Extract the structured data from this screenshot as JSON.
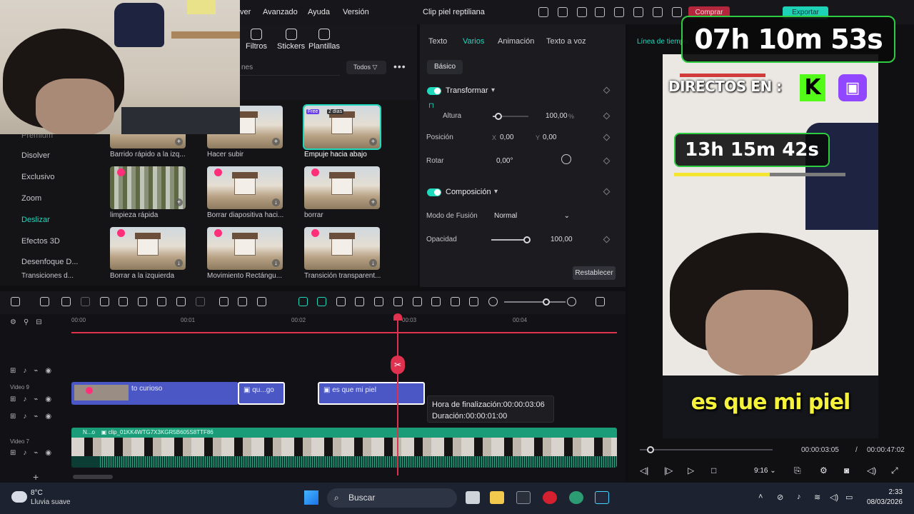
{
  "menu": {
    "items": [
      "ver",
      "Avanzado",
      "Ayuda",
      "Versión"
    ],
    "project_title": "Clip piel reptiliana",
    "buy_label": "Comprar",
    "export_label": "Exportar"
  },
  "asset_tools": {
    "filters": "Filtros",
    "stickers": "Stickers",
    "templates": "Plantillas",
    "search_placeholder": "nes",
    "filter_label": "Todos"
  },
  "categories": [
    "Premium",
    "Disolver",
    "Exclusivo",
    "Zoom",
    "Deslizar",
    "Efectos 3D",
    "Desenfoque D...",
    "Transiciones d..."
  ],
  "active_category": "Deslizar",
  "transitions": [
    "Barrido rápido a la izq...",
    "Hacer subir",
    "Empuje hacia abajo",
    "limpieza rápida",
    "Borrar diapositiva haci...",
    "borrar",
    "Borrar a la izquierda",
    "Movimiento Rectángu...",
    "Transición transparent..."
  ],
  "selected_badges": {
    "free": "Free",
    "days": "2 días"
  },
  "props": {
    "tabs": [
      "Texto",
      "Varios",
      "Animación",
      "Texto a voz"
    ],
    "active_tab": "Varios",
    "basic": "Básico",
    "transform": "Transformar",
    "height_label": "Altura",
    "height_value": "100,00",
    "height_unit": "%",
    "height_level": 0.15,
    "position_label": "Posición",
    "pos_x_label": "X",
    "pos_x": "0,00",
    "pos_y_label": "Y",
    "pos_y": "0,00",
    "rotate_label": "Rotar",
    "rotate_value": "0,00°",
    "composition": "Composición",
    "blend_label": "Modo de Fusión",
    "blend_value": "Normal",
    "opacity_label": "Opacidad",
    "opacity_value": "100,00",
    "opacity_level": 1.0,
    "reset": "Restablecer"
  },
  "player": {
    "timeline_label": "Línea de tiempo",
    "overlay_directos": "DIRECTOS EN :",
    "timer_big": "07h 10m 53s",
    "timer_small": "13h 15m 42s",
    "caption": "es que mi piel",
    "time_current": "00:00:03:05",
    "time_sep": "/",
    "time_total": "00:00:47:02",
    "ratio": "9:16",
    "progress": 0.066
  },
  "timeline": {
    "ticks": [
      "00:00",
      "00:01",
      "00:02",
      "00:03",
      "00:04"
    ],
    "track_video9": "Video 9",
    "track_video7": "Video 7",
    "clip1": "to curioso",
    "clip2": "qu...go",
    "clip3": "es que mi piel",
    "clip_video_name": "N...o",
    "clip_video_id": "clip_01KK4WTG7X3KGR5B605S8TTF86",
    "tooltip_end": "Hora de finalización:00:00:03:06",
    "tooltip_dur": "Duración:00:00:01:00"
  },
  "taskbar": {
    "temp": "8°C",
    "weather": "Lluvia suave",
    "search": "Buscar",
    "time": "2:33",
    "date": "08/03/2026"
  }
}
